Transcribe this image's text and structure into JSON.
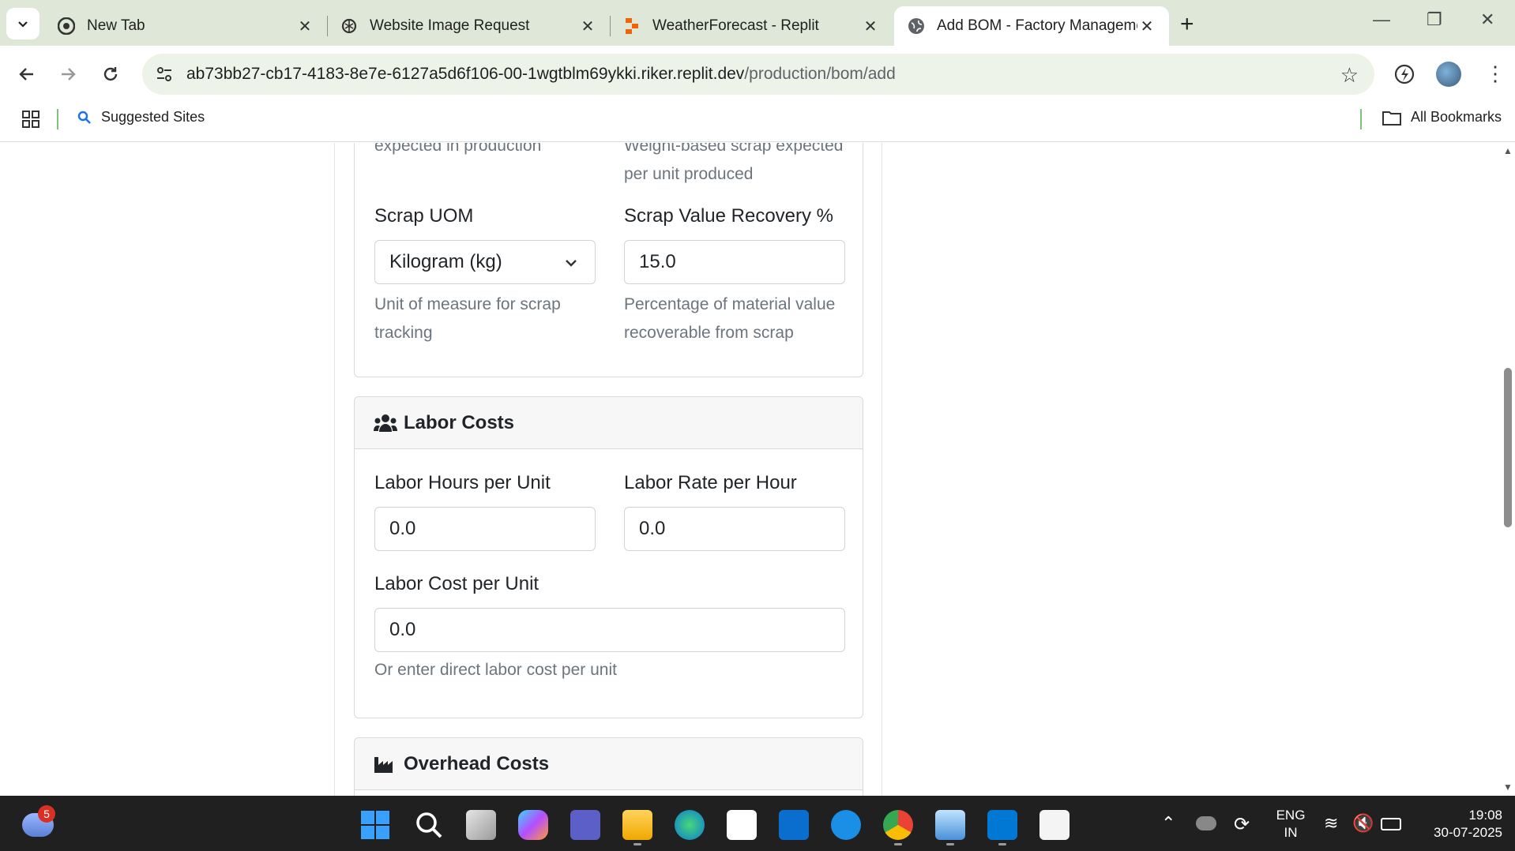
{
  "browser": {
    "tabs": [
      {
        "title": "New Tab",
        "icon": "chrome-icon"
      },
      {
        "title": "Website Image Request",
        "icon": "openai-icon"
      },
      {
        "title": "WeatherForecast - Replit",
        "icon": "replit-icon"
      },
      {
        "title": "Add BOM - Factory Management",
        "icon": "globe-icon",
        "active": true
      }
    ],
    "url_host": "ab73bb27-cb17-4183-8e7e-6127a5d6f106-00-1wgtblm69ykki.riker.replit.dev",
    "url_path": "/production/bom/add",
    "bookmarks": {
      "suggested": "Suggested Sites",
      "all": "All Bookmarks"
    }
  },
  "form": {
    "partial_help_left": "expected in production",
    "partial_help_right_1": "Weight-based scrap expected",
    "partial_help_right_2": "per unit produced",
    "scrap_uom": {
      "label": "Scrap UOM",
      "value": "Kilogram (kg)",
      "help_1": "Unit of measure for scrap",
      "help_2": "tracking"
    },
    "scrap_recovery": {
      "label": "Scrap Value Recovery %",
      "value": "15.0",
      "help_1": "Percentage of material value",
      "help_2": "recoverable from scrap"
    },
    "labor": {
      "title": "Labor Costs",
      "hours_label": "Labor Hours per Unit",
      "hours_value": "0.0",
      "rate_label": "Labor Rate per Hour",
      "rate_value": "0.0",
      "cost_label": "Labor Cost per Unit",
      "cost_value": "0.0",
      "cost_help": "Or enter direct labor cost per unit"
    },
    "overhead": {
      "title": "Overhead Costs"
    }
  },
  "taskbar": {
    "weather_badge": "5",
    "lang_1": "ENG",
    "lang_2": "IN",
    "time": "19:08",
    "date": "30-07-2025"
  }
}
